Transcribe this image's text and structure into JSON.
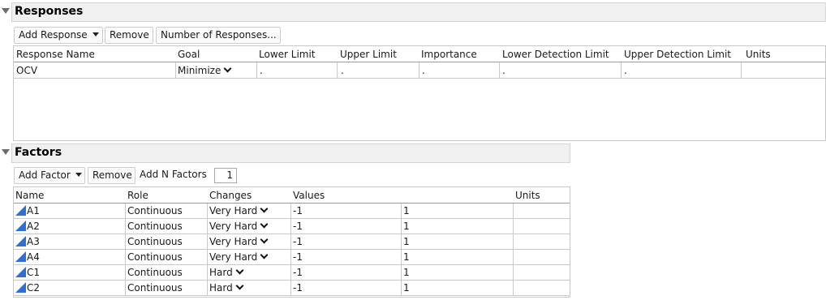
{
  "responses": {
    "title": "Responses",
    "buttons": {
      "add_response": "Add Response",
      "remove": "Remove",
      "number_of_responses": "Number of Responses..."
    },
    "columns": [
      "Response Name",
      "Goal",
      "Lower Limit",
      "Upper Limit",
      "Importance",
      "Lower Detection Limit",
      "Upper Detection Limit",
      "Units"
    ],
    "rows": [
      {
        "name": "OCV",
        "goal": "Minimize",
        "lower_limit": ".",
        "upper_limit": ".",
        "importance": ".",
        "lower_detection_limit": ".",
        "upper_detection_limit": ".",
        "units": ""
      }
    ]
  },
  "factors": {
    "title": "Factors",
    "buttons": {
      "add_factor": "Add Factor",
      "remove": "Remove",
      "add_n_factors": "Add N Factors"
    },
    "n_factors_value": "1",
    "columns": [
      "Name",
      "Role",
      "Changes",
      "Values",
      "Units"
    ],
    "rows": [
      {
        "name": "A1",
        "role": "Continuous",
        "changes": "Very Hard",
        "low": "-1",
        "high": "1",
        "units": ""
      },
      {
        "name": "A2",
        "role": "Continuous",
        "changes": "Very Hard",
        "low": "-1",
        "high": "1",
        "units": ""
      },
      {
        "name": "A3",
        "role": "Continuous",
        "changes": "Very Hard",
        "low": "-1",
        "high": "1",
        "units": ""
      },
      {
        "name": "A4",
        "role": "Continuous",
        "changes": "Very Hard",
        "low": "-1",
        "high": "1",
        "units": ""
      },
      {
        "name": "C1",
        "role": "Continuous",
        "changes": "Hard",
        "low": "-1",
        "high": "1",
        "units": ""
      },
      {
        "name": "C2",
        "role": "Continuous",
        "changes": "Hard",
        "low": "-1",
        "high": "1",
        "units": ""
      }
    ]
  },
  "icons": {
    "disclosure": "disclosure-triangle-icon",
    "dropdown": "chevron-down-icon",
    "continuous_factor": "continuous-factor-icon"
  },
  "colors": {
    "section_header_bg": "#f0f0f0",
    "factor_icon": "#2f6fd4"
  }
}
